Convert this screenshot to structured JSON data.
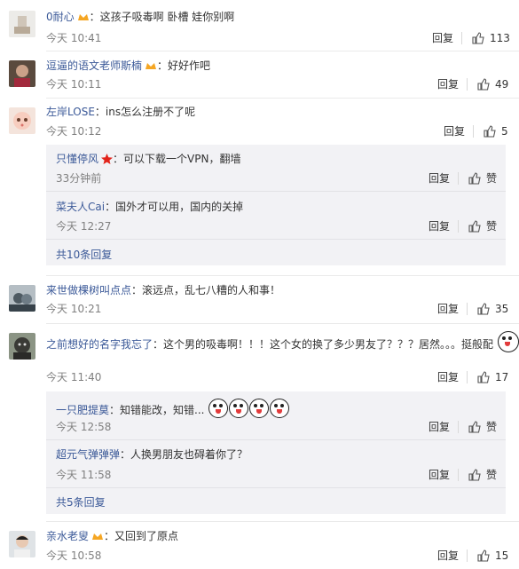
{
  "ui": {
    "reply_label": "回复",
    "praise_label": "赞"
  },
  "comments": [
    {
      "user": "0耐心",
      "badge": "vip",
      "text": "：这孩子吸毒啊 卧槽 娃你别啊",
      "time": "今天 10:41",
      "likes": "113"
    },
    {
      "user": "逗逼的语文老师斯楠",
      "badge": "vip",
      "text": "：好好作吧",
      "time": "今天 10:11",
      "likes": "49"
    },
    {
      "user": "左岸LOSE",
      "badge": "",
      "text": "：ins怎么注册不了呢",
      "time": "今天 10:12",
      "likes": "5",
      "replies": [
        {
          "user": "只懂停风",
          "badge": "star",
          "text": "：可以下载一个VPN，翻墙",
          "time": "33分钟前"
        },
        {
          "user": "菜夫人Cai",
          "badge": "",
          "text": "：国外才可以用，国内的关掉",
          "time": "今天 12:27"
        }
      ],
      "more": "共10条回复"
    },
    {
      "user": "来世做棵树叫点点",
      "badge": "",
      "text": "：滚远点，乱七八糟的人和事！",
      "time": "今天 10:21",
      "likes": "35"
    },
    {
      "user": "之前想好的名字我忘了",
      "badge": "",
      "text": "：这个男的吸毒啊！！！这个女的换了多少男友了？？？居然。。。挺般配",
      "time": "今天 11:40",
      "likes": "17",
      "replies": [
        {
          "user": "一只肥提莫",
          "badge": "",
          "text": "：知错能改，知错...",
          "time": "今天 12:58"
        },
        {
          "user": "超元气弹弹弹",
          "badge": "",
          "text": "：人换男朋友也碍着你了？",
          "time": "今天 11:58"
        }
      ],
      "more": "共5条回复"
    },
    {
      "user": "亲水老叟",
      "badge": "vip",
      "text": "：又回到了原点",
      "time": "今天 10:58",
      "likes": "15"
    }
  ]
}
